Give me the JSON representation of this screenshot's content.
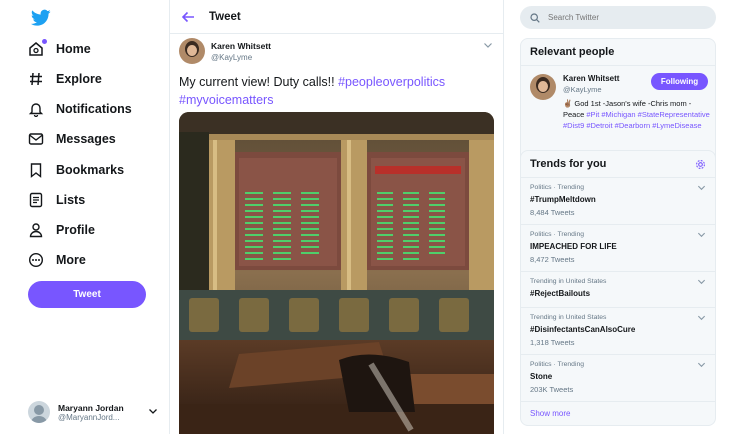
{
  "nav": {
    "items": [
      {
        "label": "Home",
        "icon": "home-icon"
      },
      {
        "label": "Explore",
        "icon": "hashtag-icon"
      },
      {
        "label": "Notifications",
        "icon": "bell-icon"
      },
      {
        "label": "Messages",
        "icon": "envelope-icon"
      },
      {
        "label": "Bookmarks",
        "icon": "bookmark-icon"
      },
      {
        "label": "Lists",
        "icon": "list-icon"
      },
      {
        "label": "Profile",
        "icon": "person-icon"
      },
      {
        "label": "More",
        "icon": "more-circle-icon"
      }
    ],
    "tweet_button": "Tweet",
    "account": {
      "name": "Maryann Jordan",
      "handle": "@MaryannJord..."
    }
  },
  "header": {
    "title": "Tweet"
  },
  "tweet": {
    "name": "Karen Whitsett",
    "handle": "@KayLyme",
    "text": "My current view! Duty calls!!",
    "hashtags": [
      "#peopleoverpolitics",
      "#myvoicematters"
    ]
  },
  "search": {
    "placeholder": "Search Twitter"
  },
  "relevant": {
    "title": "Relevant people",
    "name": "Karen Whitsett",
    "handle": "@KayLyme",
    "follow_label": "Following",
    "bio_plain": "✌🏽 God 1st -Jason's wife -Chris mom -Peace",
    "bio_tags": "#Pit #Michigan #StateRepresentative #Dist9 #Detroit #Dearborn #LymeDisease"
  },
  "trends": {
    "title": "Trends for you",
    "items": [
      {
        "meta": "Politics · Trending",
        "topic": "#TrumpMeltdown",
        "count": "8,484 Tweets"
      },
      {
        "meta": "Politics · Trending",
        "topic": "IMPEACHED FOR LIFE",
        "count": "8,472 Tweets"
      },
      {
        "meta": "Trending in United States",
        "topic": "#RejectBailouts",
        "count": ""
      },
      {
        "meta": "Trending in United States",
        "topic": "#DisinfectantsCanAlsoCure",
        "count": "1,318 Tweets"
      },
      {
        "meta": "Politics · Trending",
        "topic": "Stone",
        "count": "203K Tweets"
      }
    ],
    "show_more": "Show more"
  },
  "colors": {
    "accent": "#7856ff",
    "twitter_blue": "#1da1f2",
    "text": "#14171a",
    "muted": "#657786"
  }
}
